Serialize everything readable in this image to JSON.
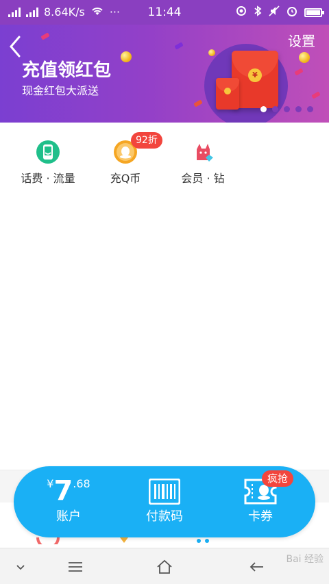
{
  "status_bar": {
    "net_speed": "8.64K/s",
    "more": "···",
    "time": "11:44"
  },
  "banner": {
    "back_icon": "chevron-left-icon",
    "settings_label": "设置",
    "title": "充值领红包",
    "subtitle": "现金红包大派送",
    "coin_symbol": "¥",
    "page_count": 5,
    "active_page": 1
  },
  "entries": [
    {
      "label": "话费 · 流量",
      "icon": "phone-topup-icon",
      "color": "#1fbf8a"
    },
    {
      "label": "充Q币",
      "icon": "qq-coin-icon",
      "color": "#f5a623",
      "badge": "92折"
    },
    {
      "label": "会员 · 钻",
      "icon": "vip-diamond-icon",
      "color": "#e94c62"
    }
  ],
  "float_bar": {
    "account": {
      "currency": "¥",
      "integer": "7",
      "decimal": ".68",
      "label": "账户"
    },
    "pay_code": {
      "label": "付款码",
      "icon": "barcode-icon"
    },
    "coupons": {
      "label": "卡券",
      "icon": "coupon-icon",
      "badge": "疯抢"
    }
  },
  "nav_bar": {
    "items": [
      "chevron-down-icon",
      "menu-icon",
      "home-icon",
      "back-icon"
    ]
  },
  "watermark": "Bai 经验",
  "colors": {
    "banner_start": "#7b3fd1",
    "banner_end": "#c04fb8",
    "float_bar": "#1ab0f5",
    "badge": "#f2453d"
  }
}
